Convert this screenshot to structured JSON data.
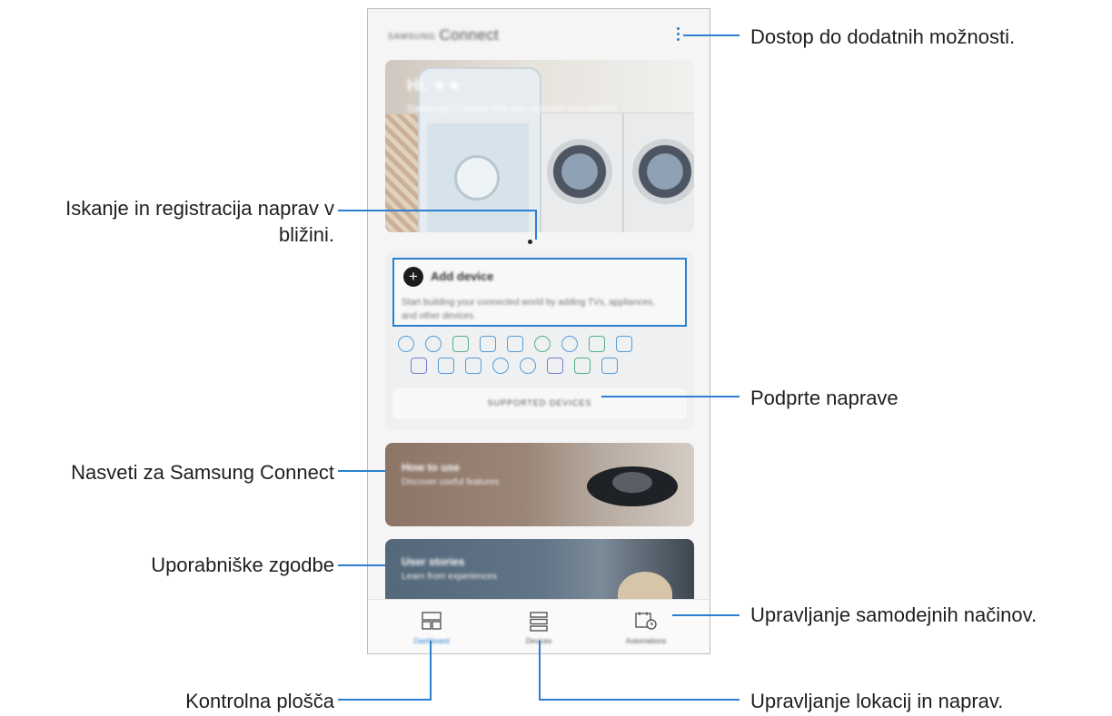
{
  "app": {
    "title_brand": "SAMSUNG",
    "title": "Connect"
  },
  "hero": {
    "title": "Hi, ★★",
    "subtitle": "Samsung Connect lets you connect and control"
  },
  "add_device": {
    "label": "Add device",
    "description": "Start building your connected world by adding TVs, appliances, and other devices."
  },
  "supported_devices_button": "SUPPORTED DEVICES",
  "tip_card": {
    "title": "How to use",
    "subtitle": "Discover useful features"
  },
  "story_card": {
    "title": "User stories",
    "subtitle": "Learn from experiences"
  },
  "bottom_nav": {
    "tabs": [
      {
        "label": "Dashboard",
        "icon": "dashboard-icon"
      },
      {
        "label": "Devices",
        "icon": "devices-list-icon"
      },
      {
        "label": "Automations",
        "icon": "calendar-clock-icon"
      }
    ]
  },
  "callouts": {
    "more_options": "Dostop do dodatnih možnosti.",
    "scan_register_line1": "Iskanje in registracija naprav v",
    "scan_register_line2": "bližini.",
    "supported_devices": "Podprte naprave",
    "tips": "Nasveti za Samsung Connect",
    "user_stories": "Uporabniške zgodbe",
    "automations": "Upravljanje samodejnih načinov.",
    "dashboard": "Kontrolna plošča",
    "locations_devices": "Upravljanje lokacij in naprav."
  },
  "colors": {
    "accent": "#2c7fd1",
    "callout_line": "#2c7fd1"
  }
}
